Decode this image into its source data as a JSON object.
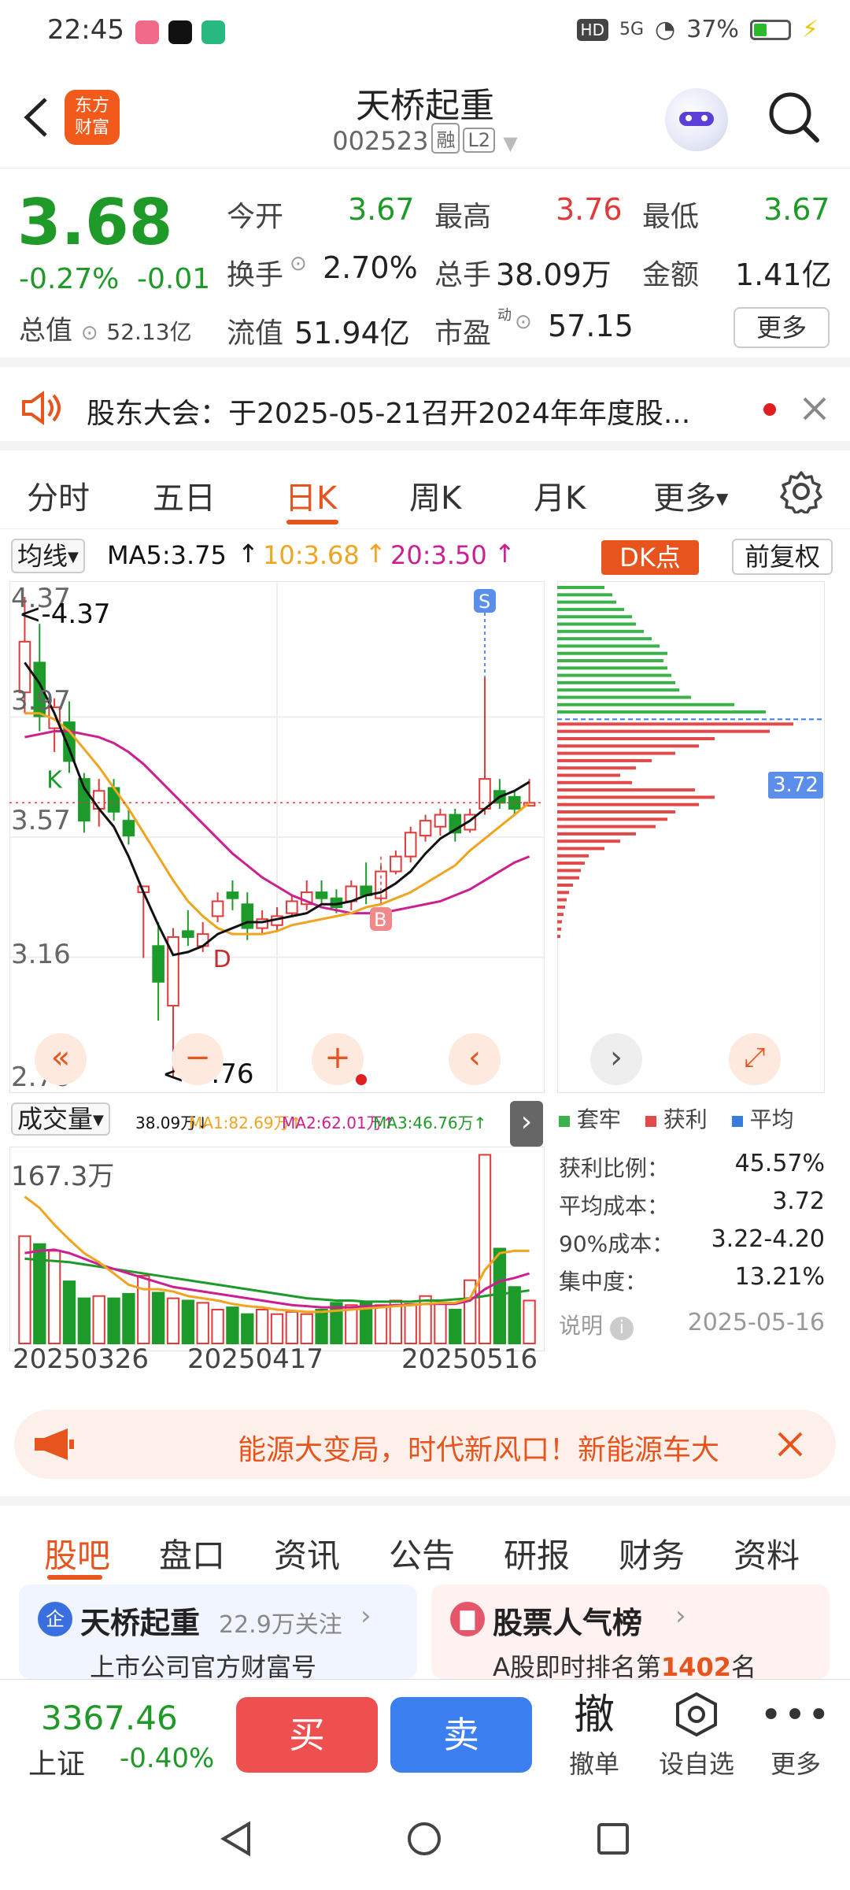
{
  "status_bar": {
    "time": "22:45",
    "net": "HD",
    "signal": "5G",
    "battery": "37%"
  },
  "header": {
    "title": "天桥起重",
    "code": "002523",
    "tag_margin": "融",
    "tag_level": "L2",
    "logo_text_1": "东方",
    "logo_text_2": "财富"
  },
  "quote": {
    "price": "3.68",
    "change_pct": "-0.27%",
    "change": "-0.01",
    "open_label": "今开",
    "open": "3.67",
    "high_label": "最高",
    "high": "3.76",
    "low_label": "最低",
    "low": "3.67",
    "turnover_label": "换手",
    "turnover": "2.70%",
    "volume_label": "总手",
    "volume": "38.09万",
    "amount_label": "金额",
    "amount": "1.41亿",
    "mktcap_label": "总值",
    "mktcap": "52.13亿",
    "float_label": "流值",
    "float": "51.94亿",
    "pe_label": "市盈",
    "pe_sup": "动",
    "pe": "57.15",
    "more": "更多"
  },
  "notice": {
    "text": "股东大会：于2025-05-21召开2024年年度股..."
  },
  "periods": [
    "分时",
    "五日",
    "日K",
    "周K",
    "月K",
    "更多"
  ],
  "ma_bar": {
    "type_label": "均线",
    "ma5": "MA5:3.75",
    "ma10": "10:3.68",
    "ma20": "20:3.50",
    "dk_label": "DK点",
    "adjust_label": "前复权"
  },
  "kline": {
    "y_ticks": [
      "4.37",
      "3.97",
      "3.57",
      "3.16",
      "2.76"
    ],
    "max_label": "<-4.37",
    "min_label": "<-2.76",
    "marker_k": "K",
    "marker_d": "D",
    "marker_s": "S",
    "marker_b": "B",
    "cost_price": "3.72"
  },
  "chart_data": {
    "type": "candlestick",
    "ylim": [
      2.76,
      4.37
    ],
    "x_ticks": [
      "20250326",
      "20250417",
      "20250516"
    ],
    "candles": [
      {
        "o": 4.05,
        "c": 4.22,
        "h": 4.37,
        "l": 3.98
      },
      {
        "o": 4.15,
        "c": 3.97,
        "h": 4.28,
        "l": 3.92
      },
      {
        "o": 3.93,
        "c": 4.0,
        "h": 4.03,
        "l": 3.85
      },
      {
        "o": 3.95,
        "c": 3.82,
        "h": 4.02,
        "l": 3.78
      },
      {
        "o": 3.76,
        "c": 3.62,
        "h": 3.78,
        "l": 3.58
      },
      {
        "o": 3.66,
        "c": 3.72,
        "h": 3.76,
        "l": 3.6
      },
      {
        "o": 3.73,
        "c": 3.65,
        "h": 3.76,
        "l": 3.62
      },
      {
        "o": 3.62,
        "c": 3.57,
        "h": 3.66,
        "l": 3.54
      },
      {
        "o": 3.38,
        "c": 3.4,
        "h": 3.4,
        "l": 3.16
      },
      {
        "o": 3.2,
        "c": 3.08,
        "h": 3.28,
        "l": 2.95
      },
      {
        "o": 3.0,
        "c": 3.23,
        "h": 3.26,
        "l": 2.76
      },
      {
        "o": 3.25,
        "c": 3.23,
        "h": 3.32,
        "l": 3.2
      },
      {
        "o": 3.2,
        "c": 3.24,
        "h": 3.28,
        "l": 3.18
      },
      {
        "o": 3.3,
        "c": 3.35,
        "h": 3.38,
        "l": 3.28
      },
      {
        "o": 3.38,
        "c": 3.36,
        "h": 3.42,
        "l": 3.32
      },
      {
        "o": 3.34,
        "c": 3.26,
        "h": 3.38,
        "l": 3.22
      },
      {
        "o": 3.26,
        "c": 3.29,
        "h": 3.32,
        "l": 3.24
      },
      {
        "o": 3.27,
        "c": 3.3,
        "h": 3.33,
        "l": 3.25
      },
      {
        "o": 3.31,
        "c": 3.35,
        "h": 3.37,
        "l": 3.3
      },
      {
        "o": 3.34,
        "c": 3.38,
        "h": 3.42,
        "l": 3.32
      },
      {
        "o": 3.38,
        "c": 3.36,
        "h": 3.42,
        "l": 3.34
      },
      {
        "o": 3.36,
        "c": 3.33,
        "h": 3.39,
        "l": 3.31
      },
      {
        "o": 3.35,
        "c": 3.4,
        "h": 3.42,
        "l": 3.32
      },
      {
        "o": 3.4,
        "c": 3.37,
        "h": 3.48,
        "l": 3.34
      },
      {
        "o": 3.36,
        "c": 3.45,
        "h": 3.47,
        "l": 3.35
      },
      {
        "o": 3.45,
        "c": 3.5,
        "h": 3.52,
        "l": 3.44
      },
      {
        "o": 3.5,
        "c": 3.58,
        "h": 3.6,
        "l": 3.48
      },
      {
        "o": 3.57,
        "c": 3.62,
        "h": 3.64,
        "l": 3.55
      },
      {
        "o": 3.6,
        "c": 3.64,
        "h": 3.66,
        "l": 3.57
      },
      {
        "o": 3.64,
        "c": 3.58,
        "h": 3.66,
        "l": 3.55
      },
      {
        "o": 3.59,
        "c": 3.64,
        "h": 3.66,
        "l": 3.58
      },
      {
        "o": 3.66,
        "c": 3.76,
        "h": 4.1,
        "l": 3.64
      },
      {
        "o": 3.72,
        "c": 3.68,
        "h": 3.76,
        "l": 3.66
      },
      {
        "o": 3.7,
        "c": 3.66,
        "h": 3.72,
        "l": 3.64
      },
      {
        "o": 3.67,
        "c": 3.68,
        "h": 3.76,
        "l": 3.67
      }
    ],
    "ma5": [
      4.15,
      4.08,
      3.98,
      3.86,
      3.73,
      3.66,
      3.6,
      3.5,
      3.38,
      3.27,
      3.17,
      3.18,
      3.2,
      3.24,
      3.26,
      3.28,
      3.28,
      3.29,
      3.3,
      3.31,
      3.34,
      3.34,
      3.35,
      3.37,
      3.38,
      3.41,
      3.45,
      3.51,
      3.56,
      3.59,
      3.62,
      3.66,
      3.7,
      3.72,
      3.75
    ],
    "ma10": [
      3.98,
      3.98,
      3.96,
      3.92,
      3.86,
      3.8,
      3.73,
      3.66,
      3.58,
      3.5,
      3.42,
      3.35,
      3.3,
      3.26,
      3.24,
      3.24,
      3.24,
      3.25,
      3.27,
      3.28,
      3.29,
      3.3,
      3.31,
      3.33,
      3.34,
      3.36,
      3.38,
      3.41,
      3.44,
      3.47,
      3.52,
      3.56,
      3.6,
      3.64,
      3.68
    ],
    "ma20": [
      3.9,
      3.91,
      3.92,
      3.92,
      3.91,
      3.9,
      3.88,
      3.85,
      3.81,
      3.76,
      3.71,
      3.66,
      3.61,
      3.56,
      3.51,
      3.47,
      3.43,
      3.4,
      3.37,
      3.35,
      3.33,
      3.32,
      3.31,
      3.31,
      3.31,
      3.32,
      3.33,
      3.34,
      3.35,
      3.37,
      3.39,
      3.42,
      3.45,
      3.48,
      3.5
    ],
    "volumes": [
      95,
      88,
      82,
      55,
      40,
      42,
      40,
      44,
      60,
      45,
      40,
      38,
      36,
      30,
      32,
      26,
      30,
      26,
      28,
      26,
      30,
      36,
      34,
      36,
      34,
      38,
      35,
      42,
      36,
      30,
      56,
      167,
      84,
      50,
      38
    ],
    "vol_ma1": [
      130,
      120,
      105,
      92,
      80,
      72,
      62,
      52,
      48,
      48,
      46,
      42,
      40,
      38,
      35,
      33,
      32,
      30,
      29,
      28,
      28,
      29,
      30,
      31,
      32,
      33,
      34,
      35,
      36,
      36,
      40,
      65,
      80,
      82,
      82
    ],
    "vol_ma2": [
      80,
      82,
      83,
      80,
      75,
      70,
      66,
      62,
      58,
      54,
      50,
      48,
      46,
      44,
      42,
      40,
      38,
      36,
      34,
      33,
      32,
      32,
      32,
      33,
      33,
      34,
      34,
      35,
      35,
      35,
      38,
      48,
      55,
      58,
      62
    ],
    "vol_ma3": [
      75,
      74,
      73,
      72,
      70,
      68,
      66,
      64,
      62,
      60,
      58,
      56,
      54,
      52,
      50,
      48,
      46,
      44,
      42,
      40,
      39,
      38,
      38,
      37,
      37,
      37,
      37,
      38,
      38,
      39,
      40,
      42,
      44,
      45,
      47
    ],
    "vol_ymax": 167.3
  },
  "volume_bar": {
    "type_label": "成交量",
    "vol": "38.09万↓",
    "ma1": "MA1:82.69万↑",
    "ma2": "MA2:62.01万↑",
    "ma3": "MA3:46.76万↑",
    "ymax_label": "167.3万"
  },
  "chip": {
    "legend_trapped": "套牢",
    "legend_profit": "获利",
    "legend_avg": "平均",
    "profit_ratio_label": "获利比例：",
    "profit_ratio": "45.57%",
    "avg_cost_label": "平均成本：",
    "avg_cost": "3.72",
    "cost90_label": "90%成本：",
    "cost90": "3.22-4.20",
    "concentration_label": "集中度：",
    "concentration": "13.21%",
    "note_label": "说明",
    "date": "2025-05-16",
    "green_bars": [
      60,
      70,
      75,
      85,
      95,
      100,
      110,
      120,
      130,
      140,
      135,
      140,
      145,
      150,
      155,
      170,
      225,
      265
    ],
    "red_bars": [
      300,
      270,
      200,
      180,
      150,
      120,
      100,
      80,
      95,
      175,
      200,
      180,
      150,
      140,
      125,
      100,
      80,
      60,
      40,
      35,
      30,
      28,
      20,
      15,
      12,
      10,
      8,
      6,
      5,
      4
    ]
  },
  "banner": {
    "text": "能源大变局，时代新风口！新能源车大"
  },
  "lower_tabs": [
    "股吧",
    "盘口",
    "资讯",
    "公告",
    "研报",
    "财务",
    "资料"
  ],
  "cards": {
    "left_title": "天桥起重",
    "left_follow": "22.9万关注",
    "left_sub": "上市公司官方财富号",
    "right_title": "股票人气榜",
    "right_sub_pre": "A股即时排名第",
    "right_rank": "1402",
    "right_sub_post": "名"
  },
  "bottom": {
    "index_value": "3367.46",
    "index_name": "上证",
    "index_change": "-0.40%",
    "buy": "买",
    "sell": "卖",
    "cancel_glyph": "撤",
    "cancel_label": "撤单",
    "watch_label": "设自选",
    "more_label": "更多"
  }
}
